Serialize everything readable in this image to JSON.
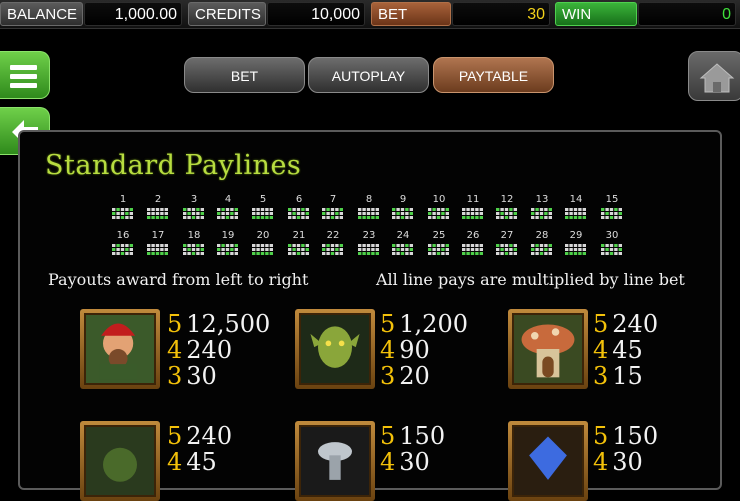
{
  "topbar": {
    "balance_label": "BALANCE",
    "balance_value": "1,000.00",
    "credits_label": "CREDITS",
    "credits_value": "10,000",
    "bet_label": "BET",
    "bet_value": "30",
    "win_label": "WIN",
    "win_value": "0"
  },
  "nav": {
    "bet": "BET",
    "autoplay": "AUTOPLAY",
    "paytable": "PAYTABLE"
  },
  "paytable": {
    "title": "Standard Paylines",
    "paylines_row1": [
      "1",
      "2",
      "3",
      "4",
      "5",
      "6",
      "7",
      "8",
      "9",
      "10",
      "11",
      "12",
      "13",
      "14",
      "15"
    ],
    "paylines_row2": [
      "16",
      "17",
      "18",
      "19",
      "20",
      "21",
      "22",
      "23",
      "24",
      "25",
      "26",
      "27",
      "28",
      "29",
      "30"
    ],
    "note_left": "Payouts award from left to right",
    "note_right": "All line pays are multiplied by line bet",
    "symbols": [
      {
        "icon": "gnome-symbol-icon",
        "payouts": [
          {
            "count": "5",
            "amount": "12,500"
          },
          {
            "count": "4",
            "amount": "240"
          },
          {
            "count": "3",
            "amount": "30"
          }
        ]
      },
      {
        "icon": "goblin-symbol-icon",
        "payouts": [
          {
            "count": "5",
            "amount": "1,200"
          },
          {
            "count": "4",
            "amount": "90"
          },
          {
            "count": "3",
            "amount": "20"
          }
        ]
      },
      {
        "icon": "mushroom-house-symbol-icon",
        "payouts": [
          {
            "count": "5",
            "amount": "240"
          },
          {
            "count": "4",
            "amount": "45"
          },
          {
            "count": "3",
            "amount": "15"
          }
        ]
      },
      {
        "icon": "frog-symbol-icon",
        "payouts": [
          {
            "count": "5",
            "amount": "240"
          },
          {
            "count": "4",
            "amount": "45"
          }
        ]
      },
      {
        "icon": "silver-goblet-symbol-icon",
        "payouts": [
          {
            "count": "5",
            "amount": "150"
          },
          {
            "count": "4",
            "amount": "30"
          }
        ]
      },
      {
        "icon": "blue-gem-symbol-icon",
        "payouts": [
          {
            "count": "5",
            "amount": "150"
          },
          {
            "count": "4",
            "amount": "30"
          }
        ]
      }
    ]
  },
  "colors": {
    "title_green": "#b7dc40",
    "count_yellow": "#f3c10a",
    "bet_value_yellow": "#f3d21a",
    "win_value_green": "#3fe03a",
    "menu_green": "#4fb52e",
    "paytable_brown": "#8c5630"
  }
}
